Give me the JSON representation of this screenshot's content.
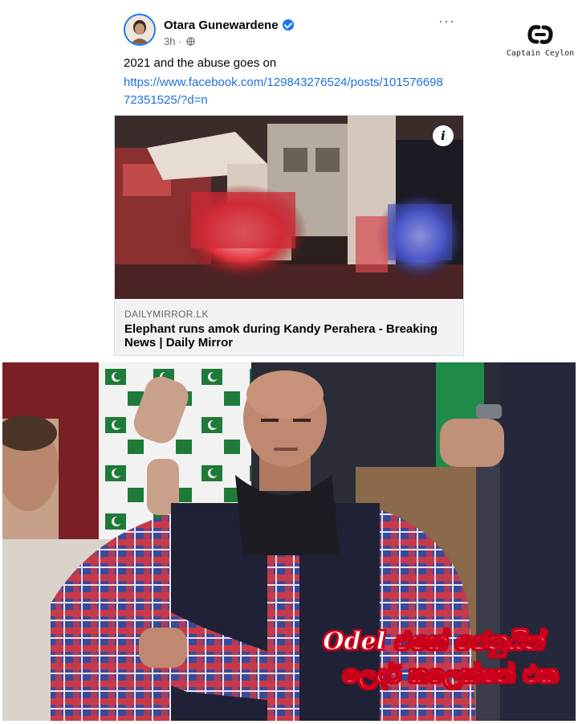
{
  "post": {
    "author": "Otara Gunewardene",
    "timestamp": "3h",
    "audience_icon": "globe-icon",
    "more_icon": "ellipsis-icon",
    "more_label": "···",
    "text": "2021 and the abuse goes on",
    "link": "https://www.facebook.com/129843276524/posts/10157669872351525/?d=n",
    "preview": {
      "info_label": "i",
      "domain": "DAILYMIRROR.LK",
      "headline": "Elephant runs amok during Kandy Perahera - Breaking News | Daily Mirror"
    }
  },
  "watermark": {
    "text": "Captain Ceylon"
  },
  "meme": {
    "caption_line1": "Odel එකේ ජෙනුයින්",
    "caption_line2": "ලෙදර් කලෙක්ෂන් එක"
  },
  "colors": {
    "link": "#216fdb",
    "verified": "#1877f2",
    "caption_outline": "#d0021b"
  }
}
